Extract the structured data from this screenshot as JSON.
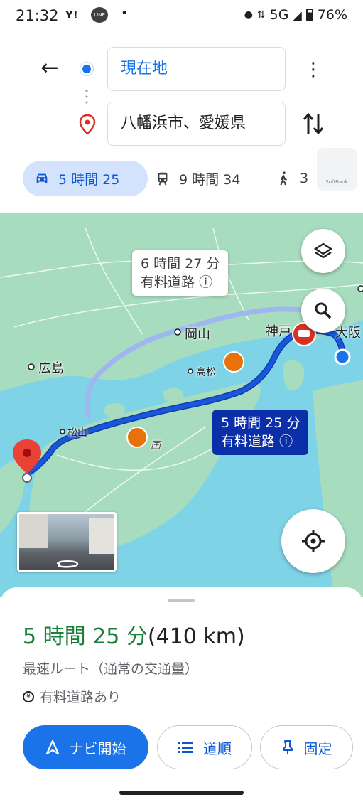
{
  "status_bar": {
    "time": "21:32",
    "icons": [
      "yahoo-icon",
      "line-icon",
      "dot-icon"
    ],
    "network": "5G",
    "battery": "76%"
  },
  "directions": {
    "origin": "現在地",
    "destination": "八幡浜市、愛媛県"
  },
  "modes": {
    "car": "5 時間 25",
    "train": "9 時間 34",
    "walk": "3"
  },
  "softbank_label": "SoftBank",
  "map": {
    "labels": {
      "okayama": "岡山",
      "kobe": "神戸",
      "osaka": "大阪",
      "hiroshima": "広島",
      "takamatsu": "高松",
      "matsuyama": "松山",
      "shikoku": "国"
    },
    "alt_route": {
      "line1": "6 時間 27 分",
      "line2": "有料道路"
    },
    "main_route": {
      "line1": "5 時間 25 分",
      "line2": "有料道路"
    },
    "colors": {
      "water": "#7fd3e6",
      "land": "#a8dcbf",
      "route": "#1a56db",
      "alt_route": "#9fb7f0"
    }
  },
  "sheet": {
    "duration": "5 時間 25 分",
    "distance": "(410 km)",
    "route_desc": "最速ルート（通常の交通量）",
    "toll": "有料道路あり",
    "buttons": {
      "start": "ナビ開始",
      "steps": "道順",
      "pin": "固定"
    }
  }
}
